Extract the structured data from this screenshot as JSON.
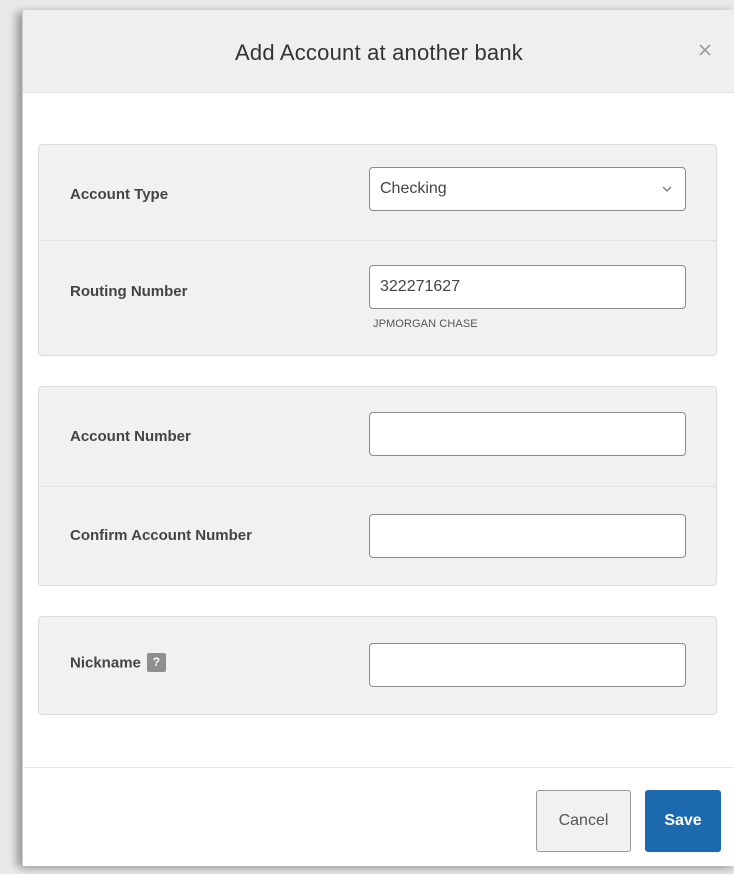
{
  "dialog": {
    "title": "Add Account at another bank",
    "close_icon": "close-icon"
  },
  "bank_panel": {
    "account_type": {
      "label": "Account Type",
      "selected": "Checking"
    },
    "routing_number": {
      "label": "Routing Number",
      "value": "322271627",
      "bank_name": "JPMORGAN CHASE"
    }
  },
  "account_panel": {
    "account_number": {
      "label": "Account Number",
      "value": ""
    },
    "confirm_account_number": {
      "label": "Confirm Account Number",
      "value": ""
    }
  },
  "nickname_panel": {
    "nickname": {
      "label": "Nickname",
      "help_badge": "?",
      "value": ""
    }
  },
  "footer": {
    "cancel_label": "Cancel",
    "save_label": "Save"
  },
  "colors": {
    "primary": "#1d69b0",
    "panel_bg": "#f1f1f1",
    "header_bg": "#efefef"
  }
}
